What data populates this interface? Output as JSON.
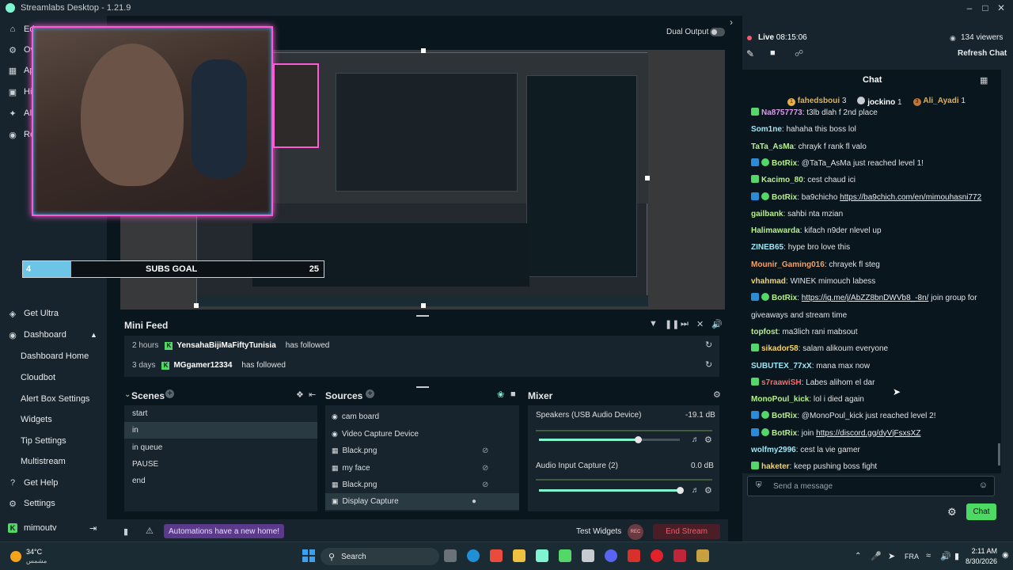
{
  "window": {
    "title": "Streamlabs Desktop - 1.21.9"
  },
  "sidebar": {
    "top_items": [
      {
        "label": "Ed"
      },
      {
        "label": "Ov"
      },
      {
        "label": "Ap"
      },
      {
        "label": "Hi"
      },
      {
        "label": "AI"
      },
      {
        "label": "Re"
      }
    ],
    "get_ultra": "Get Ultra",
    "dashboard": "Dashboard",
    "sub_items": [
      {
        "label": "Dashboard Home"
      },
      {
        "label": "Cloudbot"
      },
      {
        "label": "Alert Box Settings"
      },
      {
        "label": "Widgets"
      },
      {
        "label": "Tip Settings"
      },
      {
        "label": "Multistream"
      }
    ],
    "get_help": "Get Help",
    "settings": "Settings",
    "account": "mimoutv"
  },
  "editor": {
    "dual_output": "Dual Output",
    "subs_goal": {
      "label": "SUBS GOAL",
      "current": "4",
      "target": "25",
      "fraction": 0.16
    }
  },
  "mini_feed": {
    "title": "Mini Feed",
    "items": [
      {
        "time": "2 hours",
        "user": "YensahaBijiMaFiftyTunisia",
        "action": "has followed"
      },
      {
        "time": "3 days",
        "user": "MGgamer12334",
        "action": "has followed"
      }
    ]
  },
  "scenes": {
    "title": "Scenes",
    "items": [
      "start",
      "in",
      "in queue",
      "PAUSE",
      "end"
    ],
    "selected": 1
  },
  "sources": {
    "title": "Sources",
    "items": [
      {
        "label": "cam board",
        "icon": "camera-icon"
      },
      {
        "label": "Video Capture Device",
        "icon": "camera-icon"
      },
      {
        "label": "Black.png",
        "icon": "image-icon"
      },
      {
        "label": "my face",
        "icon": "image-icon"
      },
      {
        "label": "Black.png",
        "icon": "image-icon"
      },
      {
        "label": "Display Capture",
        "icon": "monitor-icon"
      }
    ]
  },
  "mixer": {
    "title": "Mixer",
    "channels": [
      {
        "name": "Speakers (USB Audio Device)",
        "db": "-19.1 dB",
        "level": 0.7
      },
      {
        "name": "Audio Input Capture (2)",
        "db": "0.0 dB",
        "level": 1.0
      }
    ]
  },
  "footer": {
    "automations": "Automations have a new home!",
    "test_widgets": "Test Widgets",
    "rec": "REC",
    "end_stream": "End Stream"
  },
  "stream": {
    "live_label": "Live",
    "time": "08:15:06",
    "viewers": "134 viewers",
    "refresh_chat": "Refresh Chat"
  },
  "chat": {
    "title": "Chat",
    "top": [
      {
        "rank": "1",
        "user": "fahedsboui",
        "count": "3"
      },
      {
        "rank": "",
        "user": "jockino",
        "count": "1"
      },
      {
        "rank": "3",
        "user": "Ali_Ayadi",
        "count": "1"
      }
    ],
    "messages": [
      {
        "user": "Na8757773",
        "text": "t3lb dlah f 2nd place",
        "color": "#d99ae6",
        "badges": "mod"
      },
      {
        "user": "Som1ne",
        "text": "hahaha this boss lol",
        "color": "#9ee6f5",
        "badges": ""
      },
      {
        "user": "TaTa_AsMa",
        "text": "chrayk f rank fl valo",
        "color": "#b7f08a",
        "badges": ""
      },
      {
        "user": "BotRix",
        "text": "@TaTa_AsMa just reached level 1!",
        "color": "#b7f08a",
        "badges": "bot"
      },
      {
        "user": "Kacimo_80",
        "text": "cest chaud ici",
        "color": "#b7f08a",
        "badges": "mod"
      },
      {
        "user": "BotRix",
        "text": "ba9chicho ",
        "link": "https://ba9chich.com/en/mimouhasni772",
        "color": "#b7f08a",
        "badges": "bot"
      },
      {
        "user": "gailbank",
        "text": "sahbi nta mzian",
        "color": "#b7f08a",
        "badges": ""
      },
      {
        "user": "Halimawarda",
        "text": "kifach n9der nlevel up",
        "color": "#b7f08a",
        "badges": ""
      },
      {
        "user": "ZINEB65",
        "text": "hype bro love this",
        "color": "#9ee6f5",
        "badges": ""
      },
      {
        "user": "Mounir_Gaming016",
        "text": "chrayek fl steg",
        "color": "#f0a36a",
        "badges": ""
      },
      {
        "user": "vhahmad",
        "text": "WINEK mimouch labess",
        "color": "#f5d36a",
        "badges": ""
      },
      {
        "user": "BotRix",
        "text": "",
        "link": "https://ig.me/j/AbZZ8bnDWVb8_-8n/",
        "tail": " join group for",
        "color": "#b7f08a",
        "badges": "bot"
      },
      {
        "user": "",
        "text": "giveaways and stream time",
        "color": "",
        "badges": ""
      },
      {
        "user": "topfost",
        "text": "ma3lich rani mabsout",
        "color": "#b7f08a",
        "badges": ""
      },
      {
        "user": "sikador58",
        "text": "salam alikoum everyone",
        "color": "#f5d36a",
        "badges": "mod"
      },
      {
        "user": "SUBUTEX_77xX",
        "text": "mana max now",
        "color": "#9ee6f5",
        "badges": ""
      },
      {
        "user": "s7raawiSH",
        "text": "Labes alihom el dar",
        "color": "#f07070",
        "badges": "mod"
      },
      {
        "user": "MonoPoul_kick",
        "text": "lol i died again",
        "color": "#b7f08a",
        "badges": ""
      },
      {
        "user": "BotRix",
        "text": "@MonoPoul_kick just reached level 2!",
        "color": "#b7f08a",
        "badges": "bot"
      },
      {
        "user": "BotRix",
        "text": "join ",
        "link": "https://discord.gg/dyVjFsxsXZ",
        "color": "#b7f08a",
        "badges": "bot"
      },
      {
        "user": "wolfmy2996",
        "text": "cest la vie gamer",
        "color": "#9ee6f5",
        "badges": ""
      },
      {
        "user": "haketer",
        "text": "keep pushing boss fight",
        "color": "#f5d36a",
        "badges": "mod"
      }
    ],
    "input_placeholder": "Send a message",
    "send_label": "Chat"
  },
  "taskbar": {
    "weather_temp": "34°C",
    "weather_desc": "مشمس",
    "search": "Search",
    "language": "FRA",
    "time": "2:11 AM",
    "date": "8/30/2026"
  },
  "colors": {
    "accent": "#80f5d2",
    "end_stream": "#f85a6a",
    "automations": "#5b3a8c",
    "send": "#4cd964"
  }
}
